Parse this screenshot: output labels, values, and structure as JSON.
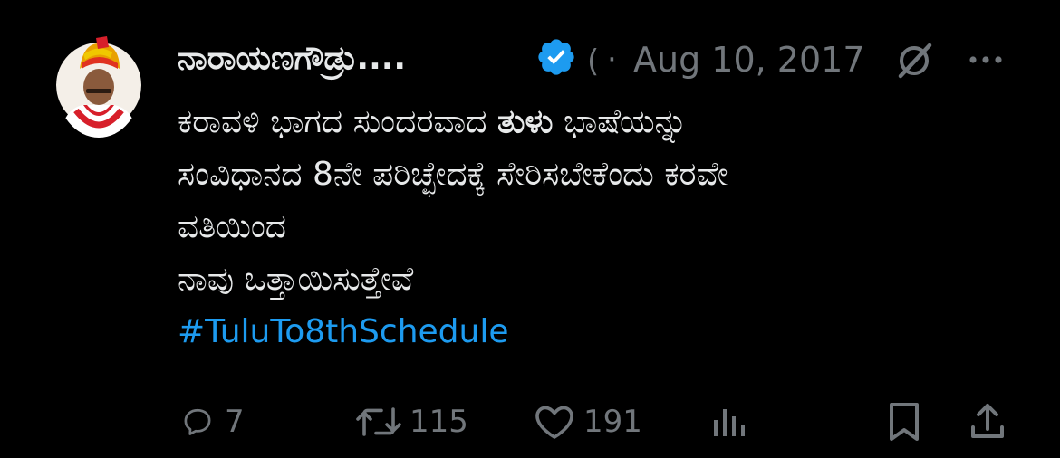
{
  "author": {
    "display_name": "ನಾರಾಯಣಗೌಡ್ರು....",
    "handle_fragment": "(",
    "separator": "·",
    "date": "Aug 10, 2017"
  },
  "tweet": {
    "line1_part1": "ಕರಾವಳಿ ಭಾಗದ ಸುಂದರವಾದ ",
    "line1_bold": "ತುಳು",
    "line1_part2": " ಭಾಷೆಯನ್ನು",
    "line2": "ಸಂವಿಧಾನದ 8ನೇ ಪರಿಚ್ಛೇದಕ್ಕೆ ಸೇರಿಸಬೇಕೆಂದು ಕರವೇ",
    "line3": "ವತಿಯಿಂದ",
    "line4": "ನಾವು ಒತ್ತಾಯಿಸುತ್ತೇವೆ",
    "hashtag": "#TuluTo8thSchedule"
  },
  "actions": {
    "reply_count": "7",
    "retweet_count": "115",
    "like_count": "191"
  },
  "colors": {
    "background": "#000000",
    "text": "#e7e9ea",
    "muted": "#71767b",
    "accent": "#1d9bf0"
  },
  "icons": [
    "verified-badge-icon",
    "grok-icon",
    "more-icon",
    "reply-icon",
    "retweet-icon",
    "like-icon",
    "views-icon",
    "bookmark-icon",
    "share-icon"
  ]
}
